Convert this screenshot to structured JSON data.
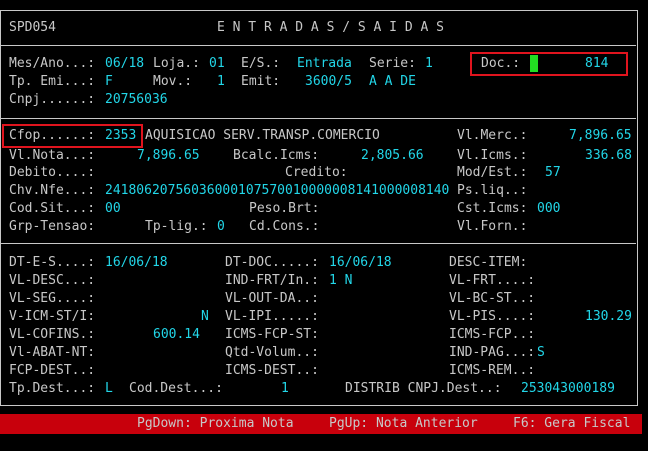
{
  "header": {
    "code": "SPD054",
    "title": "E N T R A D A S / S A I D A S"
  },
  "sec1": {
    "mes_ano_label": "Mes/Ano...:",
    "mes_ano": "06/18",
    "loja_label": "Loja.:",
    "loja": "01",
    "es_label": "E/S.:",
    "es": "Entrada",
    "serie_label": "Serie:",
    "serie": "1",
    "doc_label": "Doc.:",
    "doc": "814",
    "tp_emi_label": "Tp. Emi...:",
    "tp_emi": "F",
    "mov_label": "Mov.:",
    "mov": "1",
    "emit_label": "Emit:",
    "emit": "3600/5",
    "emit_name": "A A DE",
    "cnpj_label": "Cnpj......:",
    "cnpj": "20756036"
  },
  "sec2": {
    "cfop_label": "Cfop......:",
    "cfop": "2353",
    "cfop_desc": "AQUISICAO SERV.TRANSP.COMERCIO",
    "vl_merc_label": "Vl.Merc.:",
    "vl_merc": "7,896.65",
    "vl_nota_label": "Vl.Nota...:",
    "vl_nota": "7,896.65",
    "bcalc_label": "Bcalc.Icms:",
    "bcalc": "2,805.66",
    "vl_icms_label": "Vl.Icms.:",
    "vl_icms": "336.68",
    "debito_label": "Debito....:",
    "credito_label": "Credito:",
    "mod_est_label": "Mod/Est.:",
    "mod_est": "57",
    "chv_label": "Chv.Nfe...:",
    "chv": "24180620756036000107570010000008141000008140",
    "ps_liq_label": "Ps.liq..:",
    "cod_sit_label": "Cod.Sit...:",
    "cod_sit": "00",
    "peso_label": "Peso.Brt:",
    "cst_label": "Cst.Icms:",
    "cst": "000",
    "grp_label": "Grp-Tensao:",
    "tp_lig_label": "Tp-lig.:",
    "tp_lig": "0",
    "cd_cons_label": "Cd.Cons.:",
    "vl_forn_label": "Vl.Forn.:"
  },
  "sec3": {
    "dt_es_label": "DT-E-S....:",
    "dt_es": "16/06/18",
    "dt_doc_label": "DT-DOC.....:",
    "dt_doc": "16/06/18",
    "desc_item_label": "DESC-ITEM:",
    "vl_desc_label": "VL-DESC...:",
    "ind_frt_label": "IND-FRT/In.:",
    "ind_frt": "1 N",
    "vl_frt_label": "VL-FRT....:",
    "vl_seg_label": "VL-SEG....:",
    "vl_out_label": "VL-OUT-DA..:",
    "vl_bc_st_label": "VL-BC-ST..:",
    "v_icm_st_label": "V-ICM-ST/I:",
    "v_icm_st": "N",
    "vl_ipi_label": "VL-IPI.....:",
    "vl_pis_label": "VL-PIS....:",
    "vl_pis": "130.29",
    "vl_cofins_label": "VL-COFINS.:",
    "vl_cofins": "600.14",
    "icms_fcp_st_label": "ICMS-FCP-ST:",
    "icms_fcp_label": "ICMS-FCP..:",
    "vl_abat_label": "Vl-ABAT-NT:",
    "qtd_vol_label": "Qtd-Volum..:",
    "ind_pag_label": "IND-PAG...:",
    "ind_pag": "S",
    "fcp_dest_label": "FCP-DEST..:",
    "icms_dest_label": "ICMS-DEST..:",
    "icms_rem_label": "ICMS-REM..:",
    "tp_dest_label": "Tp.Dest...:",
    "tp_dest": "L",
    "cod_dest_label": "Cod.Dest...:",
    "cod_dest": "1",
    "distrib_label": "DISTRIB CNPJ.Dest..:",
    "cnpj_dest": "253043000189"
  },
  "footer": {
    "pgdown": "PgDown: Proxima Nota",
    "pgup": "PgUp: Nota Anterior",
    "f6": "F6: Gera Fiscal"
  },
  "colors": {
    "label": "#c8c8c8",
    "value": "#22d6e8",
    "highlight": "#e0141e",
    "cursor": "#22dd22",
    "footer_bg": "#c8000c"
  }
}
